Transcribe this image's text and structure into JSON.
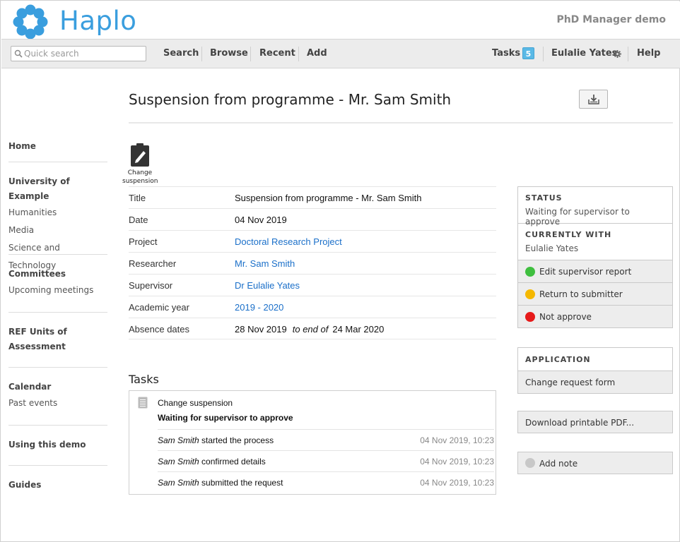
{
  "header": {
    "brand": "Haplo",
    "app_name": "PhD Manager demo"
  },
  "navbar": {
    "search_placeholder": "Quick search",
    "items": [
      "Search",
      "Browse",
      "Recent",
      "Add"
    ],
    "tasks_label": "Tasks",
    "tasks_count": "5",
    "user_name": "Eulalie Yates",
    "help_label": "Help"
  },
  "sidebar": {
    "home": "Home",
    "university": "University of Example",
    "university_links": [
      "Humanities",
      "Media",
      "Science and Technology"
    ],
    "committees": "Committees",
    "committee_links": [
      "Upcoming meetings"
    ],
    "ref_units": [
      "REF Units of",
      "Assessment"
    ],
    "calendar": "Calendar",
    "calendar_links": [
      "Past events"
    ],
    "using_demo": "Using this demo",
    "guides": "Guides"
  },
  "page": {
    "title": "Suspension from programme - Mr. Sam Smith"
  },
  "action": {
    "label_line1": "Change",
    "label_line2": "suspension"
  },
  "fields": [
    {
      "label": "Title",
      "value": "Suspension from programme - Mr. Sam Smith",
      "link": false
    },
    {
      "label": "Date",
      "value": "04 Nov 2019",
      "link": false
    },
    {
      "label": "Project",
      "value": "Doctoral Research Project",
      "link": true
    },
    {
      "label": "Researcher",
      "value": "Mr. Sam Smith",
      "link": true
    },
    {
      "label": "Supervisor",
      "value": "Dr Eulalie Yates",
      "link": true
    },
    {
      "label": "Academic year",
      "value": "2019 - 2020",
      "link": true
    }
  ],
  "absence": {
    "label": "Absence dates",
    "start": "28 Nov 2019",
    "separator": "to end of",
    "end": "24 Mar 2020"
  },
  "tasks": {
    "heading": "Tasks",
    "name": "Change suspension",
    "state": "Waiting for supervisor to approve",
    "log": [
      {
        "who": "Sam Smith",
        "what": "started the process",
        "when": "04 Nov 2019, 10:23"
      },
      {
        "who": "Sam Smith",
        "what": "confirmed details",
        "when": "04 Nov 2019, 10:23"
      },
      {
        "who": "Sam Smith",
        "what": "submitted the request",
        "when": "04 Nov 2019, 10:23"
      }
    ]
  },
  "status_panel": {
    "status_head": "STATUS",
    "status_text": "Waiting for supervisor to approve",
    "with_head": "CURRENTLY WITH",
    "with_text": "Eulalie Yates",
    "actions": [
      {
        "label": "Edit supervisor report",
        "color": "#3fbf3f"
      },
      {
        "label": "Return to submitter",
        "color": "#f5b800"
      },
      {
        "label": "Not approve",
        "color": "#e61a1a"
      }
    ]
  },
  "application_panel": {
    "head": "APPLICATION",
    "button": "Change request form"
  },
  "download_pdf": "Download printable PDF...",
  "add_note": {
    "label": "Add note",
    "color": "#c8c8c8"
  },
  "colors": {
    "brand": "#3a9ede",
    "link": "#1a6fc9",
    "badge": "#5ab9e6"
  },
  "icons": {
    "logo": "haplo-flower-logo",
    "search": "search-icon",
    "gear": "gear-icon",
    "download": "download-icon",
    "action": "clipboard-pencil-icon",
    "task": "document-icon"
  }
}
